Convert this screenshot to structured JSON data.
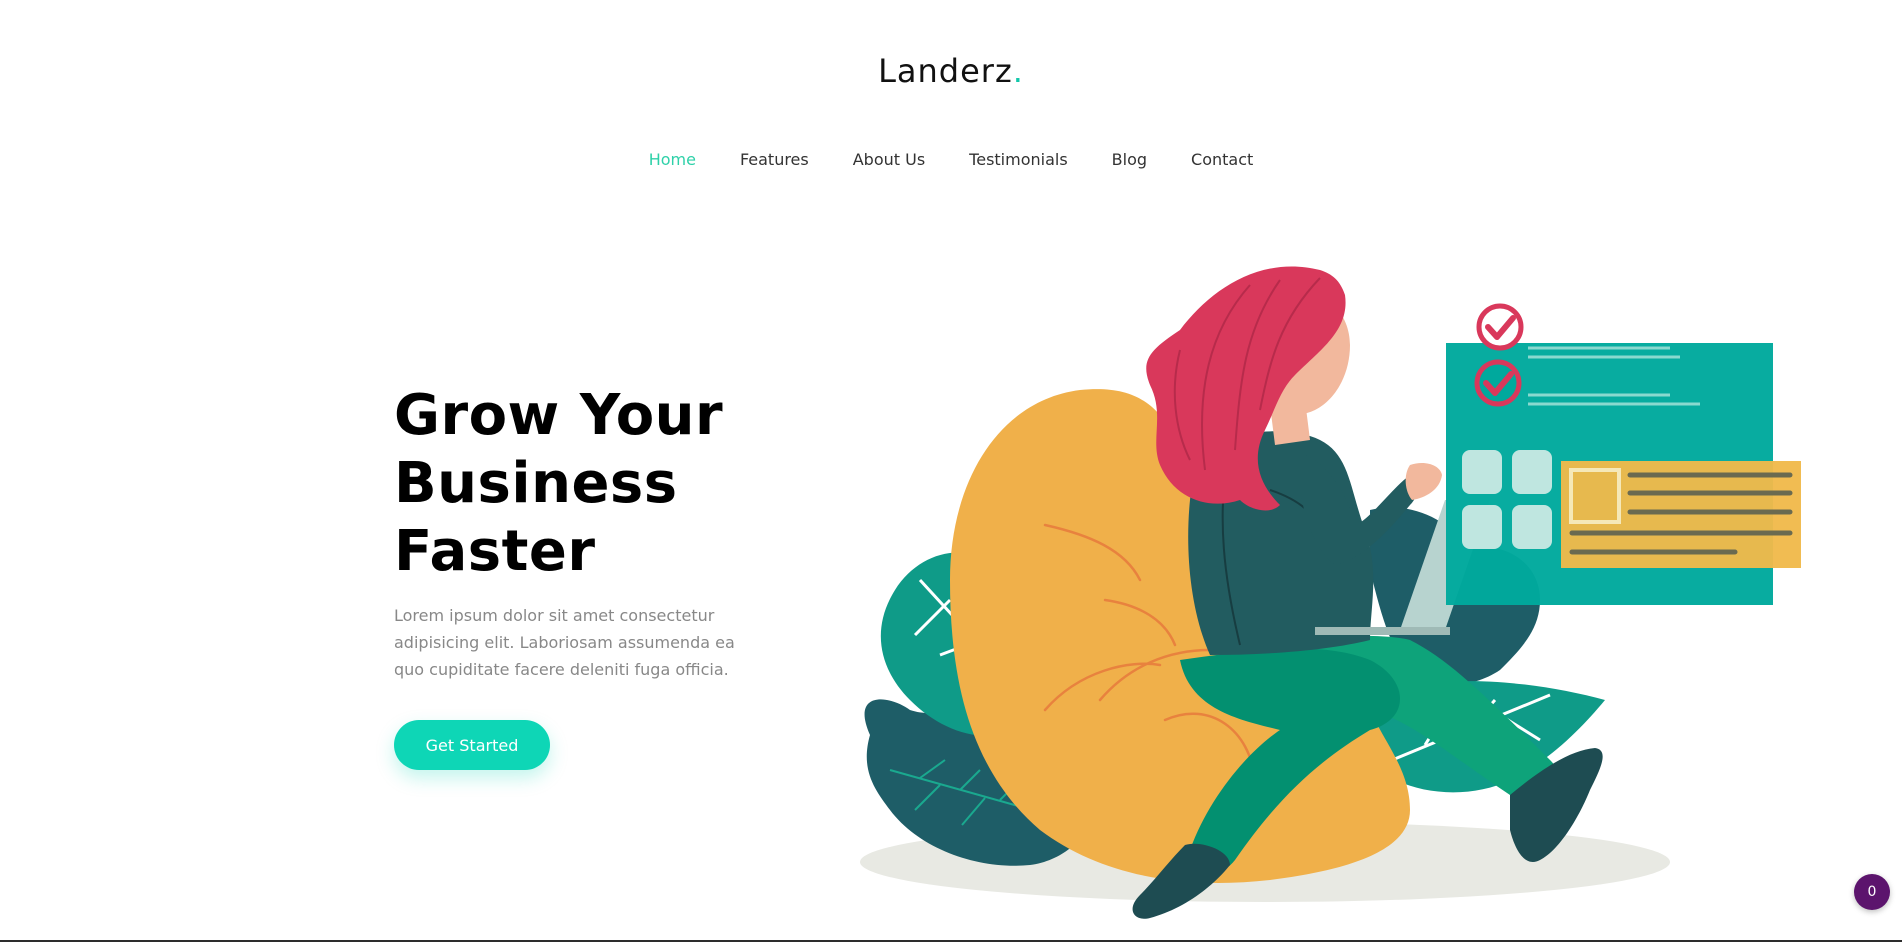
{
  "brand": {
    "name": "Landerz",
    "dot": "."
  },
  "nav": {
    "items": [
      {
        "label": "Home",
        "active": true
      },
      {
        "label": "Features",
        "active": false
      },
      {
        "label": "About Us",
        "active": false
      },
      {
        "label": "Testimonials",
        "active": false
      },
      {
        "label": "Blog",
        "active": false
      },
      {
        "label": "Contact",
        "active": false
      }
    ]
  },
  "hero": {
    "title_line1": "Grow Your",
    "title_line2": "Business",
    "title_line3": "Faster",
    "description": "Lorem ipsum dolor sit amet consectetur adipisicing elit. Laboriosam assumenda ea quo cupiditate facere deleniti fuga officia.",
    "cta_label": "Get Started"
  },
  "badge": {
    "count": "0"
  },
  "colors": {
    "accent": "#0ed6b6",
    "nav_active": "#2fd1a9",
    "hair": "#d9385b",
    "beanbag": "#f0b04a",
    "teal_card": "#00a99d",
    "leaf_dark": "#1e5d67",
    "leaf_green": "#0f9b88",
    "badge_bg": "#5c146d"
  },
  "icons": [
    "check-circle-icon"
  ]
}
